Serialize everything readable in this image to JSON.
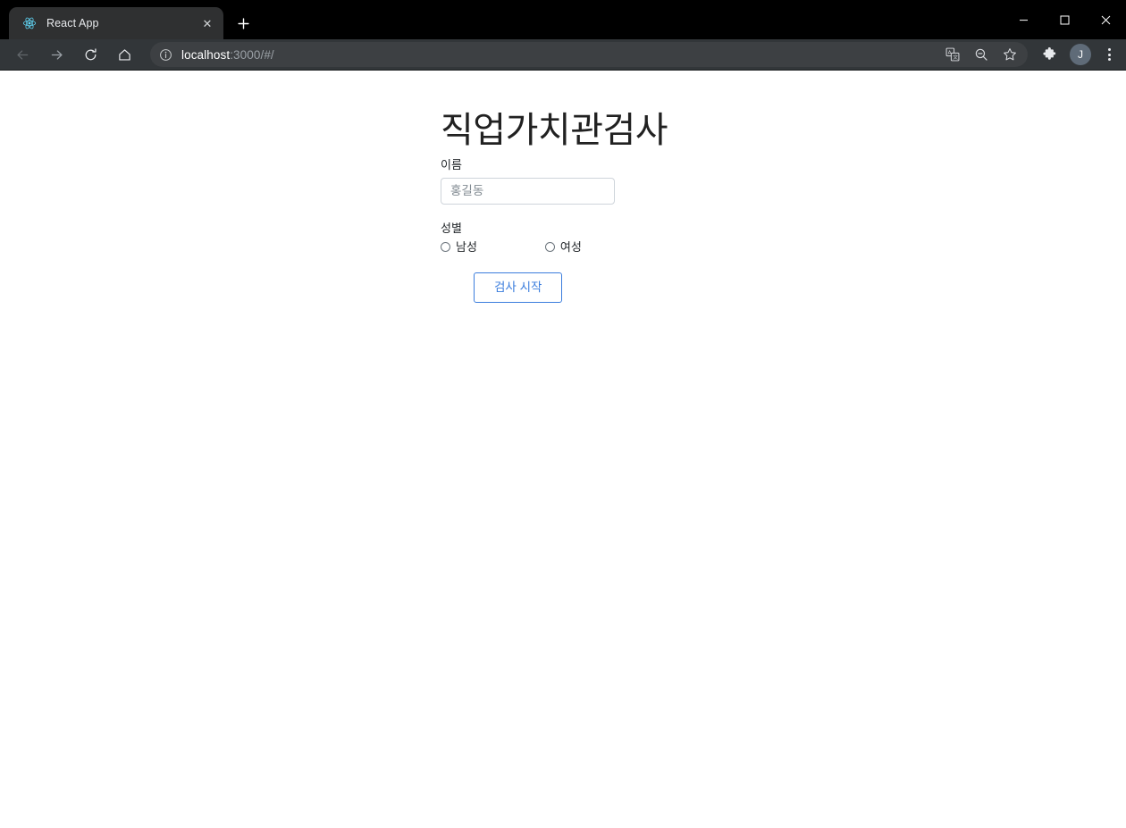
{
  "window": {
    "controls": {
      "minimize_label": "–",
      "maximize_label": "□",
      "close_label": "✕"
    }
  },
  "browser": {
    "tab": {
      "title": "React App",
      "favicon": "react-logo-icon",
      "close_label": "✕"
    },
    "new_tab_label": "+",
    "nav": {
      "back": "back-arrow-icon",
      "forward": "forward-arrow-icon",
      "reload": "reload-icon",
      "home": "home-icon"
    },
    "omnibox": {
      "security_icon": "info-circle-icon",
      "url_host": "localhost",
      "url_rest": ":3000/#/",
      "actions": [
        "translate-icon",
        "zoom-out-icon",
        "bookmark-star-icon"
      ]
    },
    "toolbar_right": {
      "extensions_icon": "puzzle-piece-icon",
      "profile_initial": "J",
      "menu_icon": "three-dot-menu-icon"
    }
  },
  "page": {
    "title": "직업가치관검사",
    "name": {
      "label": "이름",
      "value": "",
      "placeholder": "홍길동"
    },
    "gender": {
      "label": "성별",
      "options": [
        {
          "label": "남성",
          "checked": false
        },
        {
          "label": "여성",
          "checked": false
        }
      ]
    },
    "submit_label": "검사 시작"
  },
  "colors": {
    "accent_blue": "#3b7ddd",
    "chrome_titlebar": "#000000",
    "chrome_toolbar": "#323639",
    "tab_active": "#2f3031",
    "omnibox_bg": "#3d4043",
    "avatar_bg": "#5f6b78"
  }
}
